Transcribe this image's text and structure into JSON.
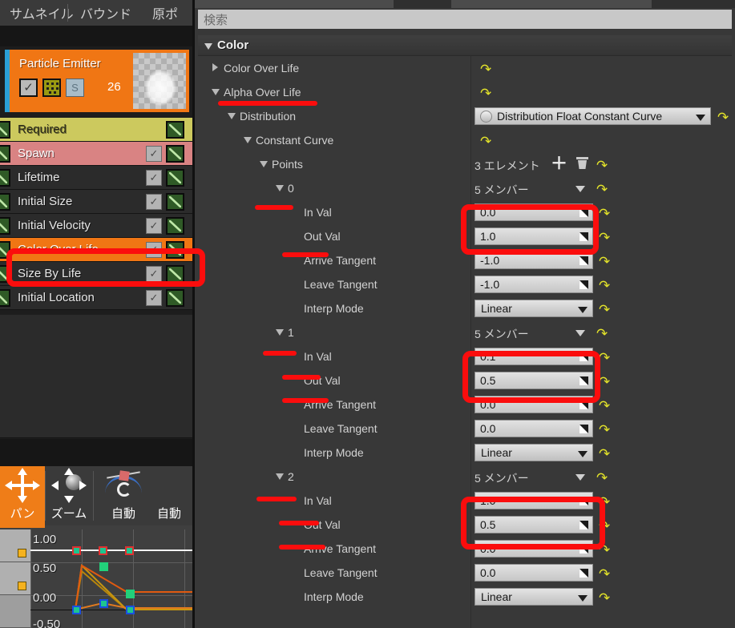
{
  "left_panel": {
    "tabs": [
      {
        "label": "サムネイル",
        "name": "tab-thumbnail"
      },
      {
        "label": "バウンド",
        "name": "tab-bounds"
      },
      {
        "label": "原ポ",
        "name": "tab-origin"
      }
    ],
    "emitter": {
      "title": "Particle Emitter",
      "count": "26",
      "enabled_checkbox": "✓",
      "solo_label": "S"
    },
    "modules": [
      {
        "label": "Required",
        "color": "#ccc95e",
        "text": "#2a2a1a",
        "checkbox": false,
        "checked": false,
        "selected": false
      },
      {
        "label": "Spawn",
        "color": "#d98383",
        "text": "#ffffff",
        "checkbox": true,
        "checked": true,
        "selected": false
      },
      {
        "label": "Lifetime",
        "color": "#2b2b2b",
        "text": "#e8e8e8",
        "checkbox": true,
        "checked": true,
        "selected": false
      },
      {
        "label": "Initial Size",
        "color": "#2b2b2b",
        "text": "#e8e8e8",
        "checkbox": true,
        "checked": true,
        "selected": false
      },
      {
        "label": "Initial Velocity",
        "color": "#2b2b2b",
        "text": "#e8e8e8",
        "checkbox": true,
        "checked": true,
        "selected": false
      },
      {
        "label": "Color Over Life",
        "color": "#f07614",
        "text": "#ffffff",
        "checkbox": true,
        "checked": true,
        "selected": true
      },
      {
        "label": "Size By Life",
        "color": "#2b2b2b",
        "text": "#e8e8e8",
        "checkbox": true,
        "checked": true,
        "selected": false
      },
      {
        "label": "Initial Location",
        "color": "#2b2b2b",
        "text": "#e8e8e8",
        "checkbox": true,
        "checked": true,
        "selected": false
      }
    ],
    "tools": [
      {
        "label": "パン",
        "name": "pan-tool",
        "icon": "move-arrows-icon",
        "active": true
      },
      {
        "label": "ズーム",
        "name": "zoom-tool",
        "icon": "zoom-arrows-icon",
        "active": false
      },
      {
        "label": "自動",
        "name": "auto-tool",
        "icon": "auto-tangent-icon",
        "active": false
      },
      {
        "label": "自動",
        "name": "auto-tool-2",
        "icon": "auto-tangent-icon",
        "active": false
      }
    ],
    "curve_editor": {
      "y_ticks": [
        "1.00",
        "0.50",
        "0.00",
        "-0.50"
      ]
    }
  },
  "right_panel": {
    "search": {
      "placeholder": "検索",
      "value": ""
    },
    "category": {
      "title": "Color"
    },
    "rows": [
      {
        "id": "color-over-life",
        "label": "Color Over Life",
        "depth": 1,
        "tri": "right",
        "value_kind": "none",
        "redo": true
      },
      {
        "id": "alpha-over-life",
        "label": "Alpha Over Life",
        "depth": 1,
        "tri": "down",
        "value_kind": "none",
        "redo": true
      },
      {
        "id": "distribution",
        "label": "Distribution",
        "depth": 2,
        "tri": "down",
        "value_kind": "combo",
        "value": "Distribution Float Constant Curve",
        "redo": true
      },
      {
        "id": "constant-curve",
        "label": "Constant Curve",
        "depth": 3,
        "tri": "down",
        "value_kind": "none",
        "redo": true
      },
      {
        "id": "points",
        "label": "Points",
        "depth": 4,
        "tri": "down",
        "value_kind": "elements",
        "value": "3 エレメント",
        "redo": true
      },
      {
        "id": "point-0",
        "label": "0",
        "depth": 5,
        "tri": "down",
        "value_kind": "members",
        "value": "5 メンバー",
        "redo": true
      },
      {
        "id": "point-0-in-val",
        "label": "In Val",
        "depth": 6,
        "tri": "none",
        "value_kind": "number",
        "value": "0.0",
        "redo": true
      },
      {
        "id": "point-0-out-val",
        "label": "Out Val",
        "depth": 6,
        "tri": "none",
        "value_kind": "number",
        "value": "1.0",
        "redo": true
      },
      {
        "id": "point-0-arrive-tangent",
        "label": "Arrive Tangent",
        "depth": 6,
        "tri": "none",
        "value_kind": "number",
        "value": "-1.0",
        "redo": true
      },
      {
        "id": "point-0-leave-tangent",
        "label": "Leave Tangent",
        "depth": 6,
        "tri": "none",
        "value_kind": "number",
        "value": "-1.0",
        "redo": true
      },
      {
        "id": "point-0-interp-mode",
        "label": "Interp Mode",
        "depth": 6,
        "tri": "none",
        "value_kind": "enum",
        "value": "Linear",
        "redo": true
      },
      {
        "id": "point-1",
        "label": "1",
        "depth": 5,
        "tri": "down",
        "value_kind": "members",
        "value": "5 メンバー",
        "redo": true
      },
      {
        "id": "point-1-in-val",
        "label": "In Val",
        "depth": 6,
        "tri": "none",
        "value_kind": "number",
        "value": "0.1",
        "redo": true
      },
      {
        "id": "point-1-out-val",
        "label": "Out Val",
        "depth": 6,
        "tri": "none",
        "value_kind": "number",
        "value": "0.5",
        "redo": true
      },
      {
        "id": "point-1-arrive-tangent",
        "label": "Arrive Tangent",
        "depth": 6,
        "tri": "none",
        "value_kind": "number",
        "value": "0.0",
        "redo": true
      },
      {
        "id": "point-1-leave-tangent",
        "label": "Leave Tangent",
        "depth": 6,
        "tri": "none",
        "value_kind": "number",
        "value": "0.0",
        "redo": true
      },
      {
        "id": "point-1-interp-mode",
        "label": "Interp Mode",
        "depth": 6,
        "tri": "none",
        "value_kind": "enum",
        "value": "Linear",
        "redo": true
      },
      {
        "id": "point-2",
        "label": "2",
        "depth": 5,
        "tri": "down",
        "value_kind": "members",
        "value": "5 メンバー",
        "redo": true
      },
      {
        "id": "point-2-in-val",
        "label": "In Val",
        "depth": 6,
        "tri": "none",
        "value_kind": "number",
        "value": "1.0",
        "redo": true
      },
      {
        "id": "point-2-out-val",
        "label": "Out Val",
        "depth": 6,
        "tri": "none",
        "value_kind": "number",
        "value": "0.5",
        "redo": true
      },
      {
        "id": "point-2-arrive-tangent",
        "label": "Arrive Tangent",
        "depth": 6,
        "tri": "none",
        "value_kind": "number",
        "value": "0.0",
        "redo": true
      },
      {
        "id": "point-2-leave-tangent",
        "label": "Leave Tangent",
        "depth": 6,
        "tri": "none",
        "value_kind": "number",
        "value": "0.0",
        "redo": true
      },
      {
        "id": "point-2-interp-mode",
        "label": "Interp Mode",
        "depth": 6,
        "tri": "none",
        "value_kind": "enum",
        "value": "Linear",
        "redo": true
      }
    ]
  },
  "colors": {
    "accent_orange": "#f07614",
    "annotation_red": "#fb0d0d",
    "panel_bg": "#383838",
    "list_bg": "#2b2b2b",
    "field_bg": "#d4d4d4",
    "redo_yellow": "#e3e32a"
  }
}
